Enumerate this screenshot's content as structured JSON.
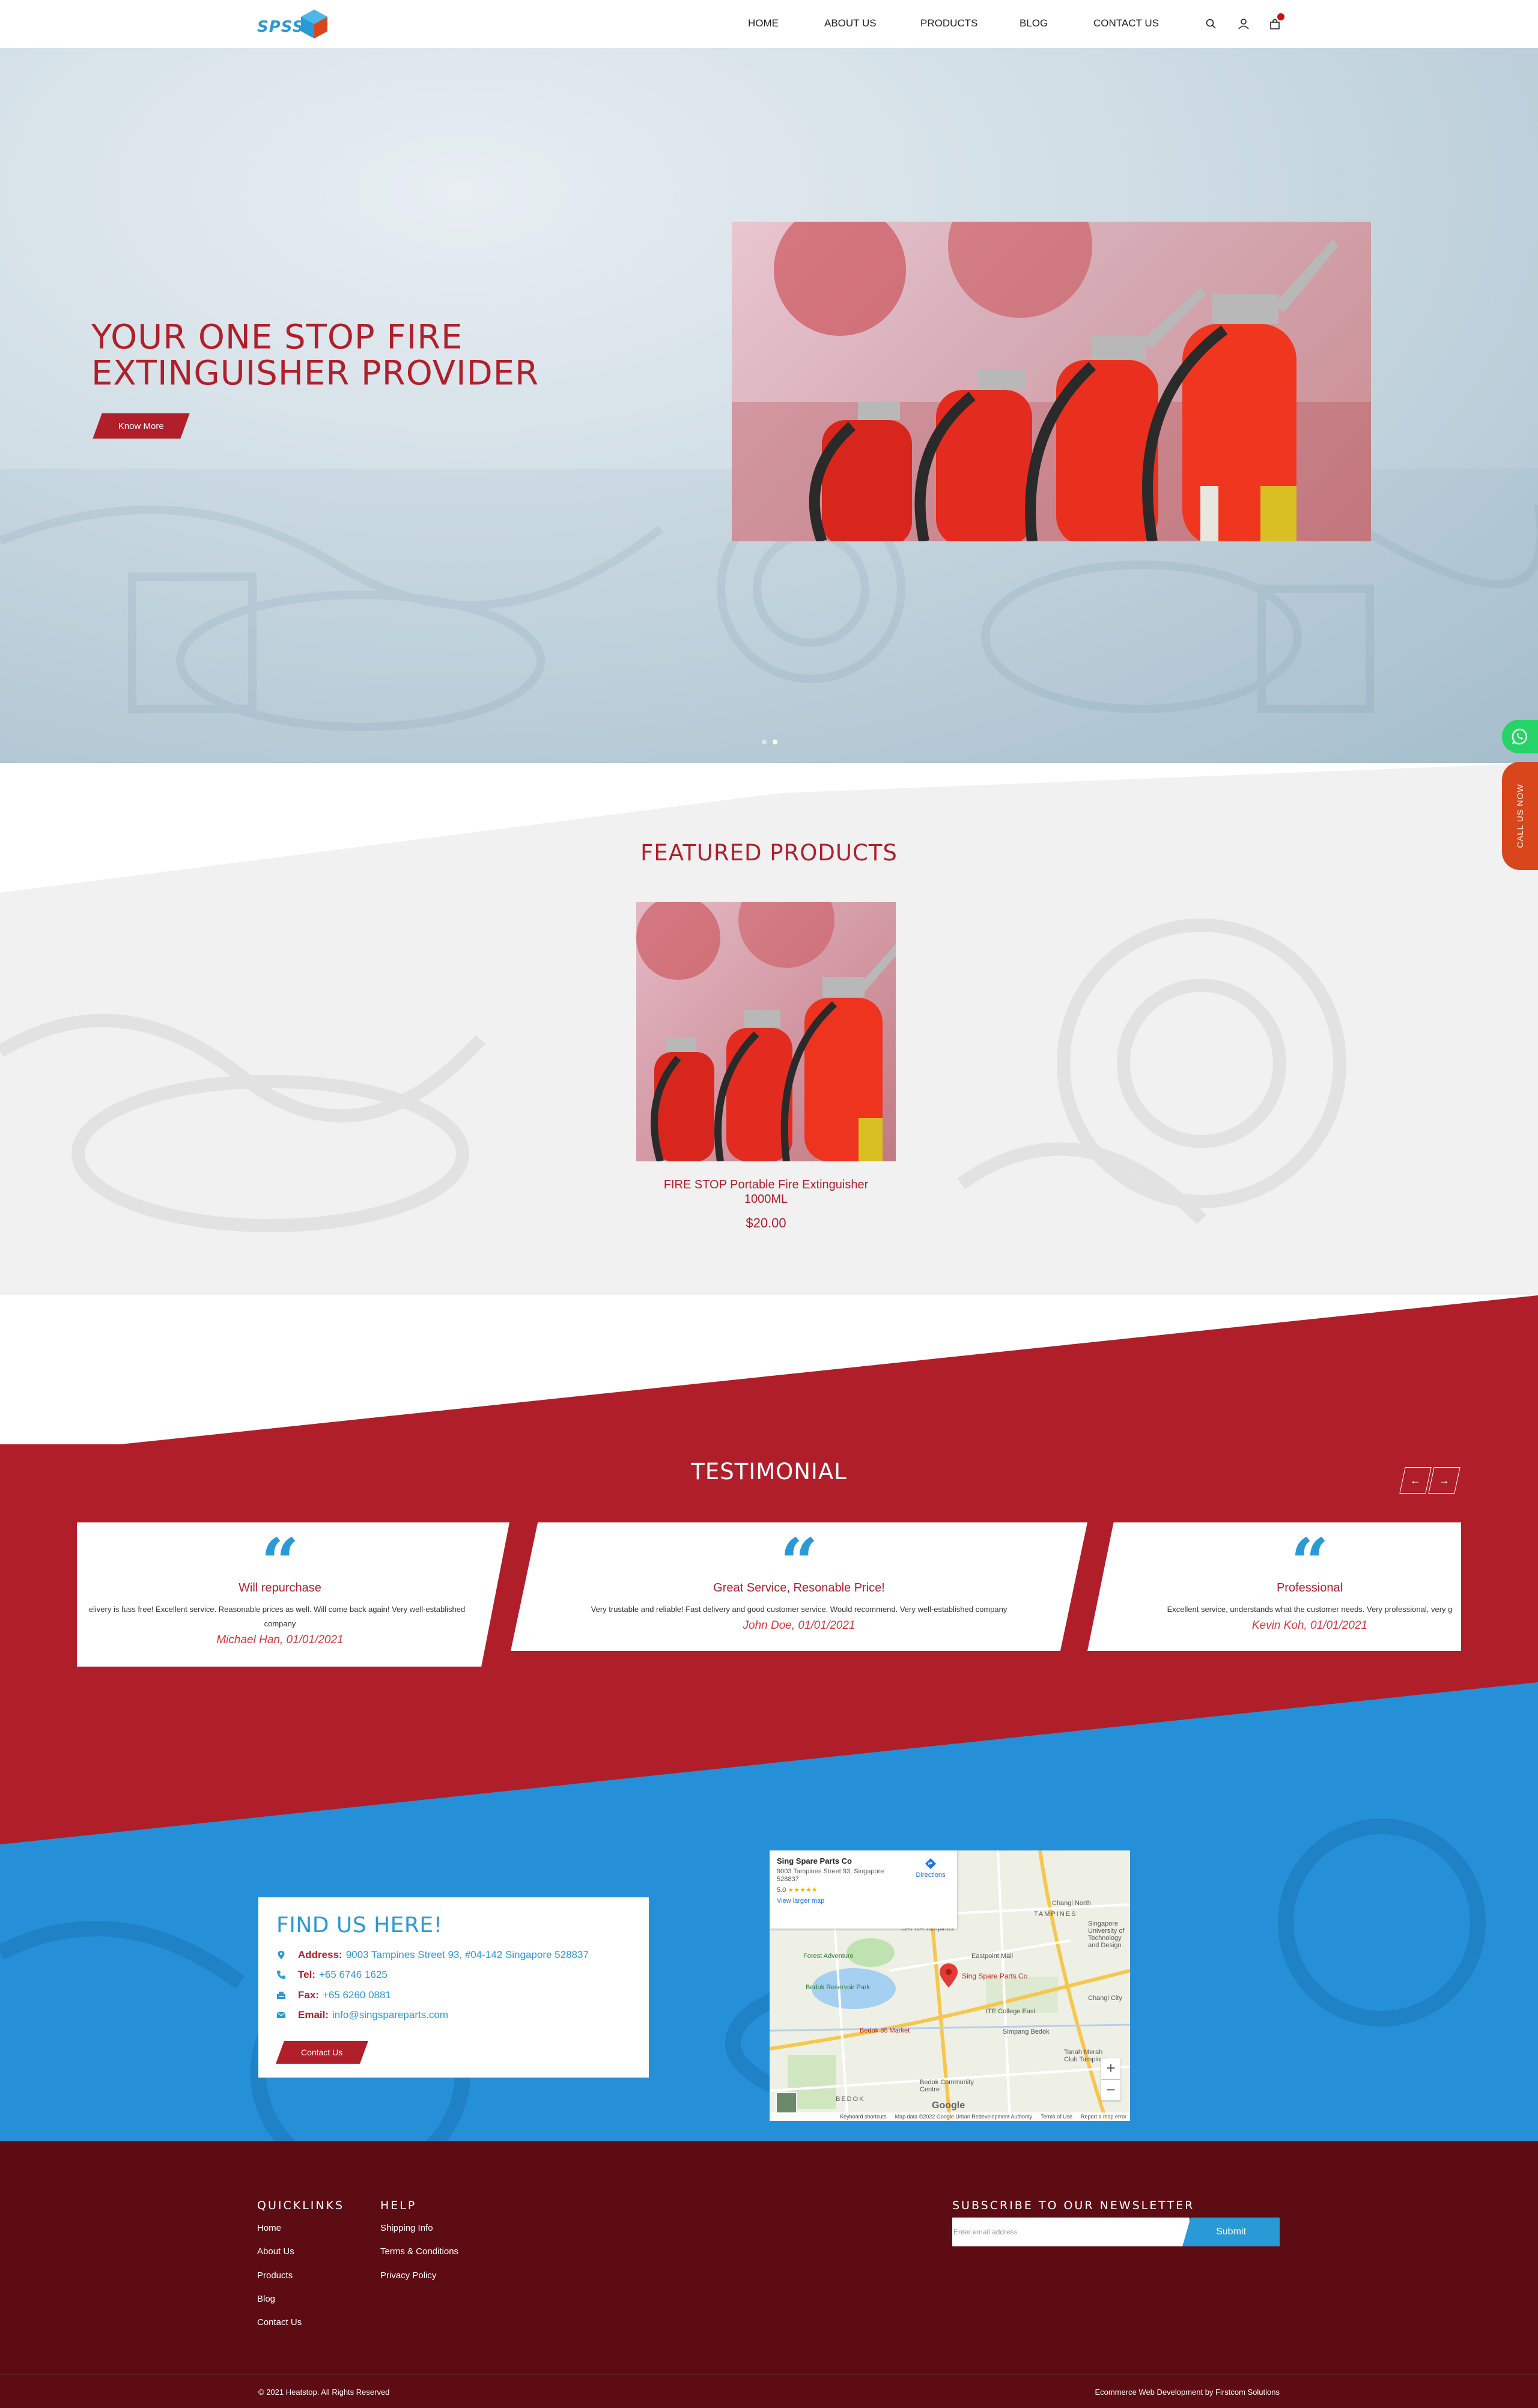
{
  "brand": {
    "logo_text": "SPSS"
  },
  "nav": {
    "items": [
      "HOME",
      "ABOUT US",
      "PRODUCTS",
      "BLOG",
      "CONTACT US"
    ],
    "icons": [
      "search-icon",
      "user-icon",
      "cart-icon"
    ]
  },
  "hero": {
    "title_line1": "YOUR ONE STOP FIRE",
    "title_line2": "EXTINGUISHER PROVIDER",
    "button": "Know More"
  },
  "featured": {
    "title": "FEATURED PRODUCTS",
    "product": {
      "name_line1": "FIRE STOP Portable Fire Extinguisher",
      "name_line2": "1000ML",
      "price": "$20.00"
    }
  },
  "testimonial": {
    "title": "TESTIMONIAL",
    "prev": "←",
    "next": "→",
    "cards": [
      {
        "title": "Will repurchase",
        "text_line1": "elivery is fuss free! Excellent service. Reasonable prices as well. Will come back again! Very well-established",
        "text_line2": "company",
        "author": "Michael Han, 01/01/2021"
      },
      {
        "title": "Great Service, Resonable Price!",
        "text_line1": "Very trustable and reliable! Fast delivery and good customer service. Would recommend. Very well-established company",
        "author": "John Doe, 01/01/2021"
      },
      {
        "title": "Professional",
        "text_line1": "Excellent service, understands what the customer needs. Very professional, very g",
        "author": "Kevin Koh, 01/01/2021"
      }
    ]
  },
  "findus": {
    "title": "FIND US HERE!",
    "address_label": "Address:",
    "address": "9003 Tampines Street 93, #04-142 Singapore 528837",
    "tel_label": "Tel:",
    "tel": "+65 6746 1625",
    "fax_label": "Fax:",
    "fax": "+65 6260 0881",
    "email_label": "Email:",
    "email": "info@singspareparts.com",
    "button": "Contact Us"
  },
  "map": {
    "place": "Sing Spare Parts Co",
    "address": "9003 Tampines Street 93, Singapore 528837",
    "rating": "5.0",
    "stars": "★★★★★",
    "view_larger": "View larger map",
    "directions": "Directions",
    "pin_label": "Sing Spare Parts Co",
    "labels": {
      "changi_north": "Changi North",
      "tampines": "TAMPINES",
      "safra": "SAFRA Tampines",
      "eastpoint": "Eastpoint Mall",
      "forest": "Forest Adventure",
      "sutd": "Singapore University of Technology and Design",
      "bedok_reservoir": "Bedok Reservoir Park",
      "ite": "ITE College East",
      "changi_city": "Changi City",
      "bedok_mall": "Bedok 85 Market",
      "simpang": "Simpang Bedok",
      "tanah_merah": "Tanah Merah Club Tampines",
      "bedok_cc": "Bedok Community Centre",
      "bedok": "BEDOK"
    },
    "zoom_in": "+",
    "zoom_out": "−",
    "google": "Google",
    "footer_items": [
      "Keyboard shortcuts",
      "Map data ©2022 Google Urban Redevelopment Authority",
      "Terms of Use",
      "Report a map error"
    ]
  },
  "footer": {
    "quicklinks_title": "QUICKLINKS",
    "quicklinks": [
      "Home",
      "About Us",
      "Products",
      "Blog",
      "Contact Us"
    ],
    "help_title": "HELP",
    "help": [
      "Shipping Info",
      "Terms & Conditions",
      "Privacy Policy"
    ],
    "newsletter_title": "SUBSCRIBE TO OUR NEWSLETTER",
    "newsletter_placeholder": "Enter email address",
    "newsletter_button": "Submit",
    "copyright": "© 2021 Heatstop. All Rights Reserved",
    "credits": "Ecommerce Web Development by Firstcom Solutions"
  },
  "side": {
    "call": "CALL US NOW"
  },
  "colors": {
    "brand_red": "#b11f2a",
    "brand_blue": "#2a9ad6",
    "footer_bg": "#5d0c14",
    "whatsapp": "#25d366",
    "call": "#d9461c"
  }
}
